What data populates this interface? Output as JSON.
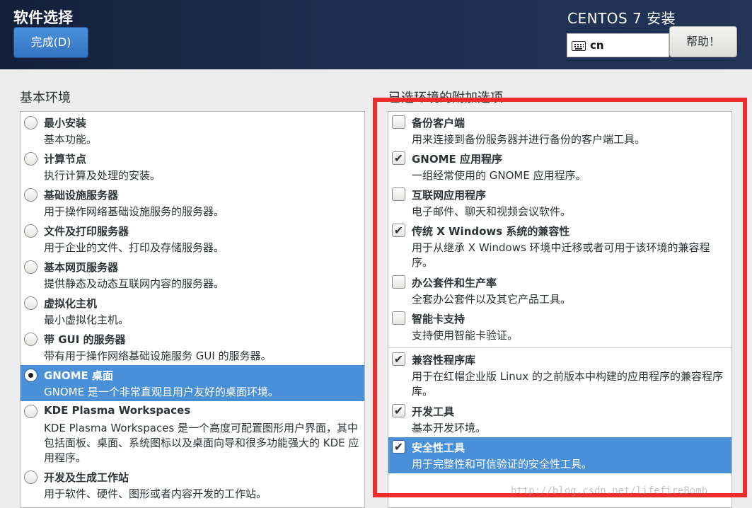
{
  "header": {
    "page_title": "软件选择",
    "done_button": "完成(D)",
    "product_title": "CENTOS 7 安装",
    "keyboard_layout": "cn",
    "help_button": "帮助！"
  },
  "base_environment": {
    "heading": "基本环境",
    "items": [
      {
        "title": "最小安装",
        "desc": "基本功能。",
        "selected": false
      },
      {
        "title": "计算节点",
        "desc": "执行计算及处理的安装。",
        "selected": false
      },
      {
        "title": "基础设施服务器",
        "desc": "用于操作网络基础设施服务的服务器。",
        "selected": false
      },
      {
        "title": "文件及打印服务器",
        "desc": "用于企业的文件、打印及存储服务器。",
        "selected": false
      },
      {
        "title": "基本网页服务器",
        "desc": "提供静态及动态互联网内容的服务器。",
        "selected": false
      },
      {
        "title": "虚拟化主机",
        "desc": "最小虚拟化主机。",
        "selected": false
      },
      {
        "title": "带 GUI 的服务器",
        "desc": "带有用于操作网络基础设施服务 GUI 的服务器。",
        "selected": false
      },
      {
        "title": "GNOME 桌面",
        "desc": "GNOME 是一个非常直观且用户友好的桌面环境。",
        "selected": true
      },
      {
        "title": "KDE Plasma Workspaces",
        "desc": "KDE Plasma Workspaces 是一个高度可配置图形用户界面，其中包括面板、桌面、系统图标以及桌面向导和很多功能强大的 KDE 应用程序。",
        "selected": false
      },
      {
        "title": "开发及生成工作站",
        "desc": "用于软件、硬件、图形或者内容开发的工作站。",
        "selected": false
      }
    ]
  },
  "addons": {
    "heading": "已选环境的附加选项",
    "items": [
      {
        "title": "备份客户端",
        "desc": "用来连接到备份服务器并进行备份的客户端工具。",
        "checked": false,
        "selected": false
      },
      {
        "title": "GNOME 应用程序",
        "desc": "一组经常使用的 GNOME 应用程序。",
        "checked": true,
        "selected": false
      },
      {
        "title": "互联网应用程序",
        "desc": "电子邮件、聊天和视频会议软件。",
        "checked": false,
        "selected": false
      },
      {
        "title": "传统 X Windows 系统的兼容性",
        "desc": "用于从继承 X Windows 环境中迁移或者可用于该环境的兼容程序。",
        "checked": true,
        "selected": false
      },
      {
        "title": "办公套件和生产率",
        "desc": "全套办公套件以及其它产品工具。",
        "checked": false,
        "selected": false
      },
      {
        "title": "智能卡支持",
        "desc": "支持使用智能卡验证。",
        "checked": false,
        "selected": false
      },
      {
        "title": "兼容性程序库",
        "desc": "用于在红帽企业版 Linux 的之前版本中构建的应用程序的兼容程序库。",
        "checked": true,
        "selected": false
      },
      {
        "title": "开发工具",
        "desc": "基本开发环境。",
        "checked": true,
        "selected": false
      },
      {
        "title": "安全性工具",
        "desc": "用于完整性和可信验证的安全性工具。",
        "checked": true,
        "selected": true
      }
    ]
  },
  "check_mark": "✔",
  "watermark": "http://blog.csdn.net/lifefireBomb",
  "colors": {
    "selected_row": "#4a90d9",
    "highlight_box": "#ee2c2c",
    "header_bg": "#1d2e4e"
  }
}
